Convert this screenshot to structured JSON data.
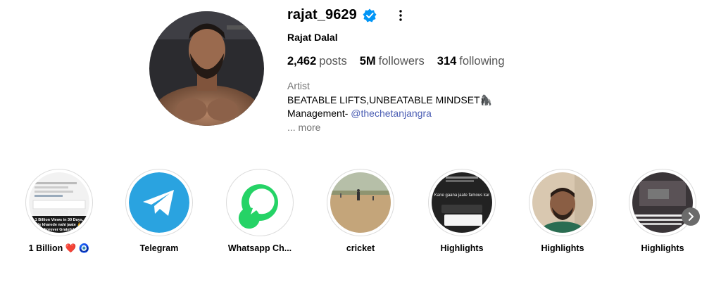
{
  "profile": {
    "username": "rajat_9629",
    "full_name": "Rajat Dalal",
    "verified": true,
    "stats": [
      {
        "count": "2,462",
        "label": "posts"
      },
      {
        "count": "5M",
        "label": "followers"
      },
      {
        "count": "314",
        "label": "following"
      }
    ],
    "bio": {
      "category": "Artist",
      "line1": "BEATABLE LIFTS,UNBEATABLE MINDSET",
      "line1_emoji": "🦍",
      "management_prefix": "Management- ",
      "management_handle": "@thechetanjangra",
      "more_label": "... more"
    }
  },
  "highlights": [
    {
      "label": "1 Billion ❤️ 🧿",
      "thumb": "screenshot",
      "thumb_text": [
        "1 Billion Views in 30 Days,",
        "Ye kharede nahi jaate 🙏",
        "Forever Grateful"
      ]
    },
    {
      "label": "Telegram",
      "thumb": "telegram-logo"
    },
    {
      "label": "Whatsapp Ch...",
      "thumb": "whatsapp-logo"
    },
    {
      "label": "cricket",
      "thumb": "cricket-field"
    },
    {
      "label": "Highlights",
      "thumb": "chat-screenshot",
      "thumb_text": [
        "Kane gaana jaate famous kar"
      ]
    },
    {
      "label": "Highlights",
      "thumb": "man-portrait"
    },
    {
      "label": "Highlights",
      "thumb": "dark-screenshot"
    }
  ],
  "colors": {
    "verified_blue": "#0095f6",
    "link": "#4a5db3",
    "secondary_text": "#737373",
    "ring": "#dbdbdb"
  }
}
